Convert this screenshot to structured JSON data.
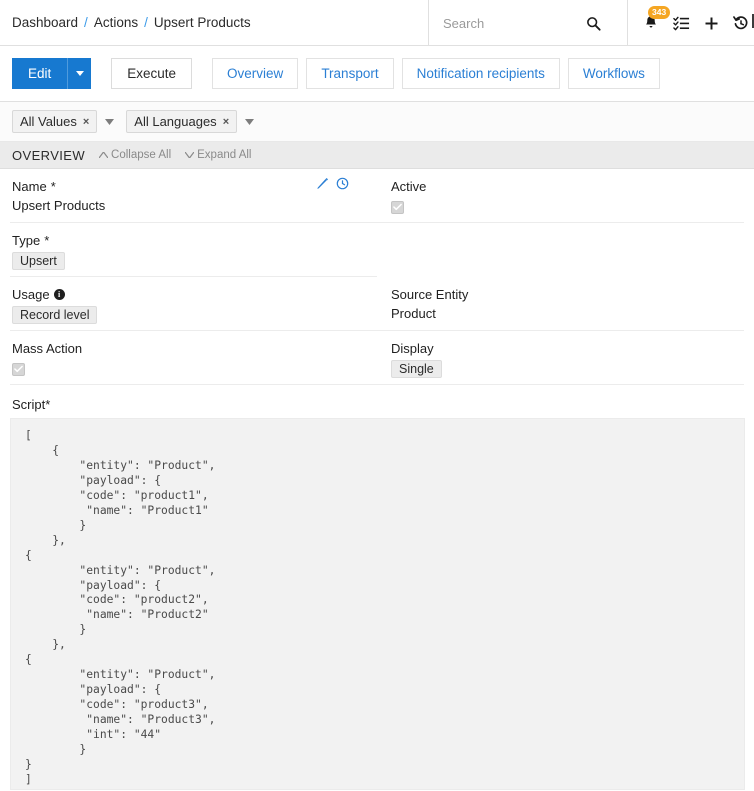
{
  "header": {
    "breadcrumb": [
      {
        "label": "Dashboard",
        "sep": "/"
      },
      {
        "label": "Actions",
        "sep": "/"
      },
      {
        "label": "Upsert Products",
        "sep": ""
      }
    ],
    "search": {
      "placeholder": "Search",
      "value": ""
    },
    "icons": {
      "search": "search-icon",
      "bell": "bell-icon",
      "bell_badge": "343",
      "tasks": "task-list-icon",
      "add": "plus-icon",
      "history": "history-icon"
    }
  },
  "actionbar": {
    "edit_label": "Edit",
    "execute_label": "Execute",
    "tabs": [
      {
        "label": "Overview"
      },
      {
        "label": "Transport"
      },
      {
        "label": "Notification recipients"
      },
      {
        "label": "Workflows"
      }
    ]
  },
  "filters": {
    "chips": [
      {
        "label": "All Values",
        "close": "×"
      },
      {
        "label": "All Languages",
        "close": "×"
      }
    ]
  },
  "section": {
    "title": "OVERVIEW",
    "collapse_all": "Collapse All",
    "expand_all": "Expand All"
  },
  "fields": {
    "name": {
      "label": "Name",
      "required": "*",
      "value": "Upsert Products"
    },
    "active": {
      "label": "Active",
      "checked": true
    },
    "type": {
      "label": "Type",
      "required": "*",
      "value": "Upsert"
    },
    "usage": {
      "label": "Usage",
      "info": "i",
      "value": "Record level"
    },
    "source_entity": {
      "label": "Source Entity",
      "value": "Product"
    },
    "mass_action": {
      "label": "Mass Action",
      "checked": true
    },
    "display": {
      "label": "Display",
      "value": "Single"
    },
    "script": {
      "label": "Script",
      "required": "*"
    }
  },
  "script_content": "[\n    {\n        \"entity\": \"Product\",\n        \"payload\": {\n        \"code\": \"product1\",\n         \"name\": \"Product1\"\n        }\n    },\n{\n        \"entity\": \"Product\",\n        \"payload\": {\n        \"code\": \"product2\",\n         \"name\": \"Product2\"\n        }\n    },\n{\n        \"entity\": \"Product\",\n        \"payload\": {\n        \"code\": \"product3\",\n         \"name\": \"Product3\",\n         \"int\": \"44\"\n        }\n}\n]",
  "colors": {
    "primary": "#1779d0",
    "link": "#2b7fd4",
    "badge": "#f5a623",
    "script_bg": "#f2f2f2",
    "section_bg": "#ebebeb"
  }
}
